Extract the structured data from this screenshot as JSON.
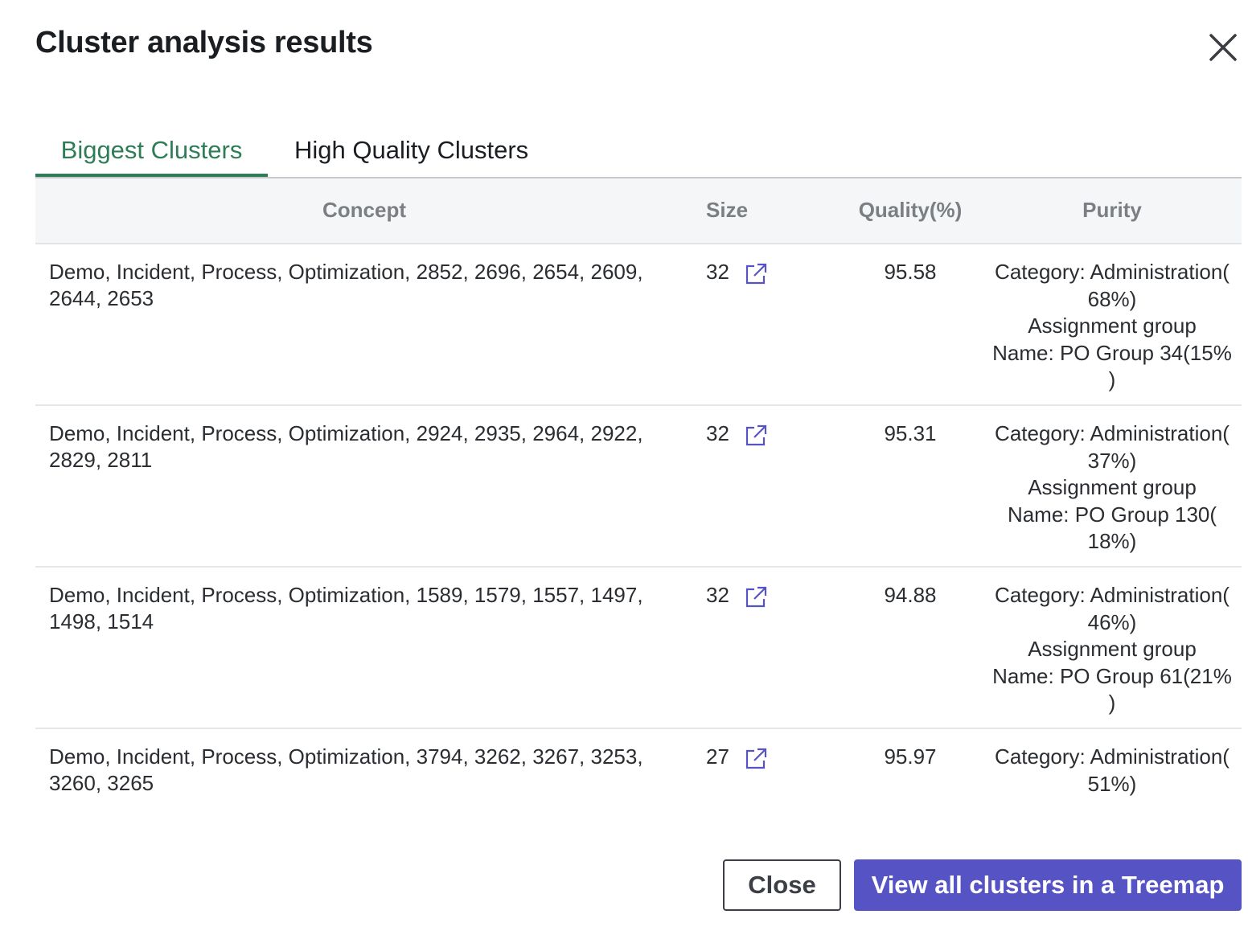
{
  "dialog": {
    "title": "Cluster analysis results"
  },
  "tabs": [
    {
      "label": "Biggest Clusters",
      "active": true
    },
    {
      "label": "High Quality Clusters",
      "active": false
    }
  ],
  "table": {
    "headers": {
      "concept": "Concept",
      "size": "Size",
      "quality": "Quality(%)",
      "purity": "Purity"
    },
    "rows": [
      {
        "concept": "Demo, Incident, Process, Optimization, 2852, 2696, 2654, 2609, 2644, 2653",
        "size": "32",
        "quality": "95.58",
        "purity": [
          "Category: Administration(",
          "68%)",
          "Assignment group",
          "Name: PO Group 34(15%",
          ")"
        ]
      },
      {
        "concept": "Demo, Incident, Process, Optimization, 2924, 2935, 2964, 2922, 2829, 2811",
        "size": "32",
        "quality": "95.31",
        "purity": [
          "Category: Administration(",
          "37%)",
          "Assignment group",
          "Name: PO Group 130(",
          "18%)"
        ]
      },
      {
        "concept": "Demo, Incident, Process, Optimization, 1589, 1579, 1557, 1497, 1498, 1514",
        "size": "32",
        "quality": "94.88",
        "purity": [
          "Category: Administration(",
          "46%)",
          "Assignment group",
          "Name: PO Group 61(21%",
          ")"
        ]
      },
      {
        "concept": "Demo, Incident, Process, Optimization, 3794, 3262, 3267, 3253, 3260, 3265",
        "size": "27",
        "quality": "95.97",
        "purity": [
          "Category: Administration(",
          "51%)"
        ]
      }
    ]
  },
  "footer": {
    "close_label": "Close",
    "treemap_label": "View all clusters in a Treemap"
  },
  "icons": {
    "close": "close-icon",
    "open_in_new": "external-link-icon"
  },
  "colors": {
    "accent_green": "#2e7d57",
    "primary_button": "#5654c5"
  }
}
